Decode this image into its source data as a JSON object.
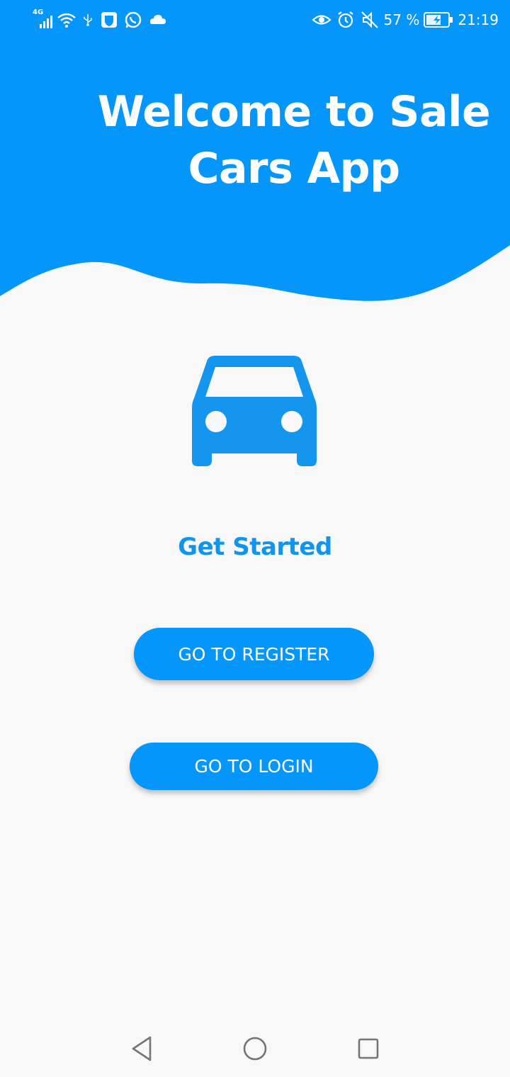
{
  "colors": {
    "primary": "#0496fb",
    "car_icon": "#1596ee",
    "get_started": "#0f95ee",
    "background": "#f8f8f8"
  },
  "status_bar": {
    "network": "4G",
    "battery_percent": "57 %",
    "time": "21:19",
    "left_icons": [
      "signal-icon",
      "wifi-icon",
      "usb-icon",
      "shield-app-icon",
      "whatsapp-icon",
      "cloud-icon"
    ],
    "right_icons": [
      "eye-icon",
      "alarm-icon",
      "mute-icon",
      "battery-charging-icon"
    ]
  },
  "header": {
    "title": "Welcome to Sale Cars App"
  },
  "main": {
    "hero_icon": "car-icon",
    "get_started_label": "Get Started",
    "register_button_label": "GO TO REGISTER",
    "login_button_label": "GO TO LOGIN"
  },
  "navigation_bar": {
    "buttons": [
      "back-icon",
      "home-icon",
      "recents-icon"
    ]
  }
}
